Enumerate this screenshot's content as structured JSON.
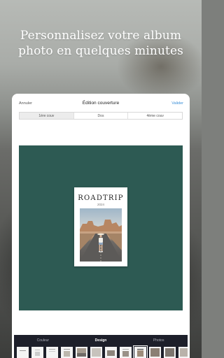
{
  "promo": {
    "headline": "Personnalisez votre album\nphoto en quelques minutes"
  },
  "editor": {
    "topbar": {
      "left_label": "Annuler",
      "title": "Édition couverture",
      "right_label": "Valider"
    },
    "tabs": [
      {
        "label": "1ère couv",
        "active": true
      },
      {
        "label": "Dos",
        "active": false
      },
      {
        "label": "4ème couv",
        "active": false
      }
    ],
    "canvas_color": "#2d5a53",
    "cover": {
      "title": "ROADTRIP",
      "year": "2024"
    }
  },
  "bottom_panel": {
    "tabs": [
      {
        "label": "Couleur",
        "active": false
      },
      {
        "label": "Design",
        "active": true
      },
      {
        "label": "Photos",
        "active": false
      }
    ]
  },
  "colors": {
    "accent": "#3b8fd8",
    "bottom_bar": "#1d1f2a"
  }
}
